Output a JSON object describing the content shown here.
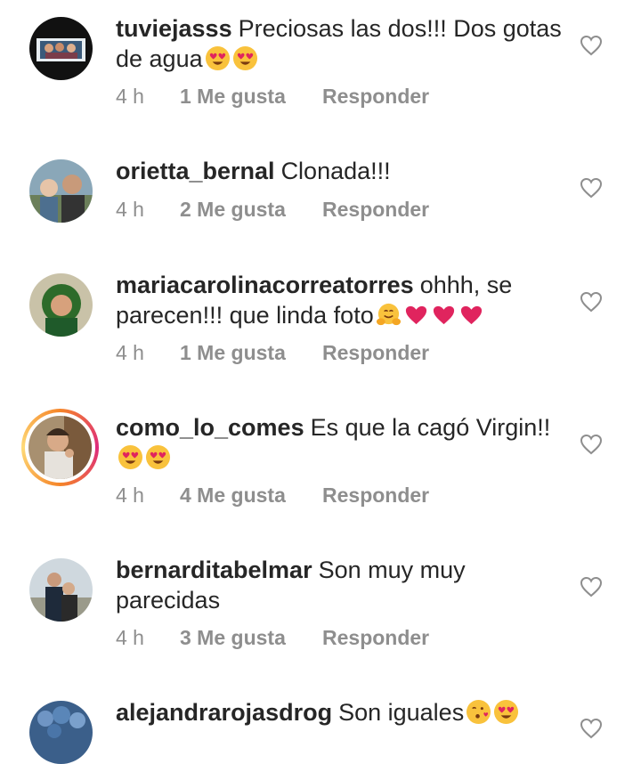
{
  "comments": [
    {
      "username": "tuviejasss",
      "text": "Preciosas las dos!!! Dos gotas de agua",
      "emojis": [
        "heart-eyes-icon",
        "heart-eyes-icon"
      ],
      "time": "4 h",
      "likes": "1 Me gusta",
      "reply": "Responder"
    },
    {
      "username": "orietta_bernal",
      "text": "Clonada!!!",
      "emojis": [],
      "time": "4 h",
      "likes": "2 Me gusta",
      "reply": "Responder"
    },
    {
      "username": "mariacarolinacorreatorres",
      "text": "ohhh, se parecen!!! que linda foto",
      "emojis": [
        "hugging-face-icon",
        "pink-heart-icon",
        "pink-heart-icon",
        "pink-heart-icon"
      ],
      "time": "4 h",
      "likes": "1 Me gusta",
      "reply": "Responder"
    },
    {
      "username": "como_lo_comes",
      "text": "Es que la cagó Virgin!!",
      "emojis": [
        "heart-eyes-icon",
        "heart-eyes-icon"
      ],
      "time": "4 h",
      "likes": "4 Me gusta",
      "reply": "Responder",
      "has_story_ring": true
    },
    {
      "username": "bernarditabelmar",
      "text": "Son muy muy parecidas",
      "emojis": [],
      "time": "4 h",
      "likes": "3 Me gusta",
      "reply": "Responder"
    },
    {
      "username": "alejandrarojasdrog",
      "text": "Son iguales",
      "emojis": [
        "kissing-heart-icon",
        "heart-eyes-icon"
      ]
    }
  ],
  "colors": {
    "text": "#262626",
    "meta": "#8e8e8e",
    "heart_outline": "#8e8e8e",
    "pink_heart": "#e0245e",
    "emoji_yellow": "#f9c23c"
  }
}
